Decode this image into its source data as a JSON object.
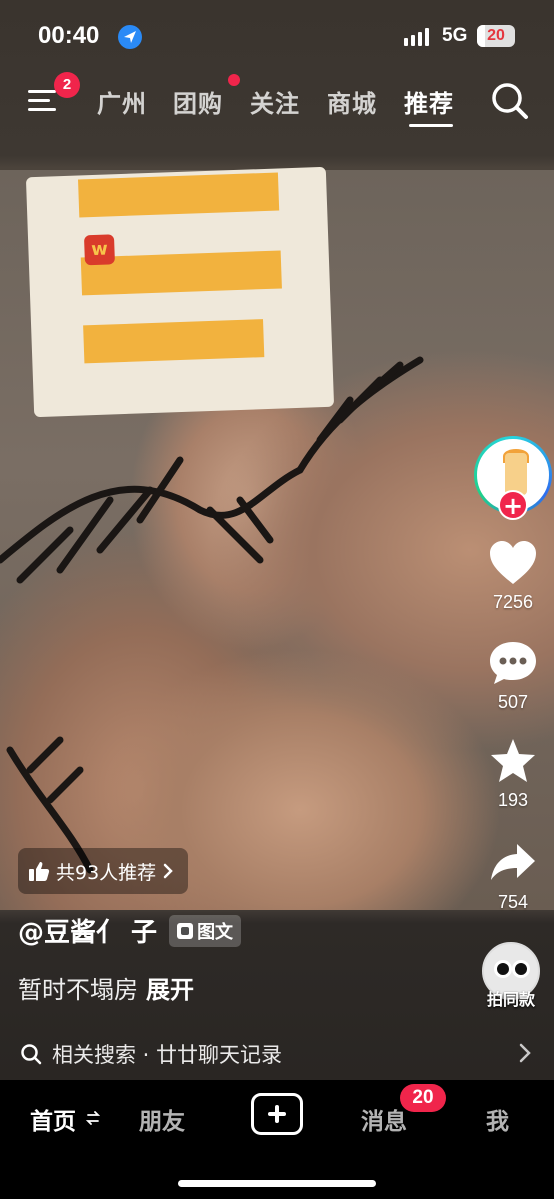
{
  "status_bar": {
    "time": "00:40",
    "network": "5G",
    "battery": "20",
    "battery_level": 0.2
  },
  "top_nav": {
    "menu_badge": "2",
    "tabs": [
      {
        "label": "广州"
      },
      {
        "label": "团购"
      },
      {
        "label": "关注"
      },
      {
        "label": "商城"
      },
      {
        "label": "推荐"
      }
    ],
    "active_tab": "推荐"
  },
  "rail": {
    "likes": "7256",
    "comments": "507",
    "favorites": "193",
    "shares": "754",
    "same_style_label": "拍同款"
  },
  "post": {
    "recommend_text": "共93人推荐",
    "author": "@豆酱亻 子",
    "type_tag": "图文",
    "description": "暂时不塌房",
    "expand": "展开"
  },
  "related_search": {
    "text": "相关搜索 · 廿廿聊天记录"
  },
  "tabbar": {
    "home": "首页",
    "friends": "朋友",
    "messages": "消息",
    "messages_badge": "20",
    "me": "我"
  },
  "colors": {
    "accent_red": "#f0254b",
    "location_blue": "#2a8af6"
  },
  "icons": [
    "location-icon",
    "signal-icon",
    "menu-icon",
    "search-icon",
    "heart-icon",
    "comment-icon",
    "star-icon",
    "share-icon",
    "thumbs-up-icon",
    "chevron-right-icon",
    "refresh-icon",
    "plus-icon"
  ]
}
